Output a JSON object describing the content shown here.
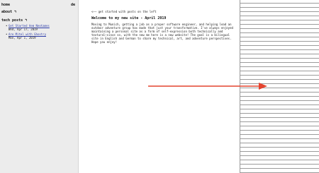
{
  "nav": {
    "home": "home",
    "lang": "de",
    "about": "about ↰",
    "tech_posts": "tech posts ↰"
  },
  "posts": [
    {
      "title": "Get Started Aem Neotames",
      "date": "Wed, Apr 17, 2019"
    },
    {
      "title": "Are Mitel with Ghostry",
      "date": "Mon, Apr 1, 2019"
    }
  ],
  "main": {
    "hint": "<—— get started with posts on the left",
    "title": "Welcome to my new site - April 2019",
    "intro": "Moving to Munich, getting a job as a proper software engineer, and helping lead an outdoor adventure group has made that just your transformative. I've always enjoyed maintaining a personal site as a form of self-expression both technically and textural—since so, with the new me here is a new website! The goal is a bilingual site in English and German to share my technical, art, and adventure perspectives. Hope you enjoy!"
  },
  "colors": {
    "arrow": "#e4442f",
    "link": "#2a3aa8",
    "sidebar_bg": "#ececec"
  }
}
